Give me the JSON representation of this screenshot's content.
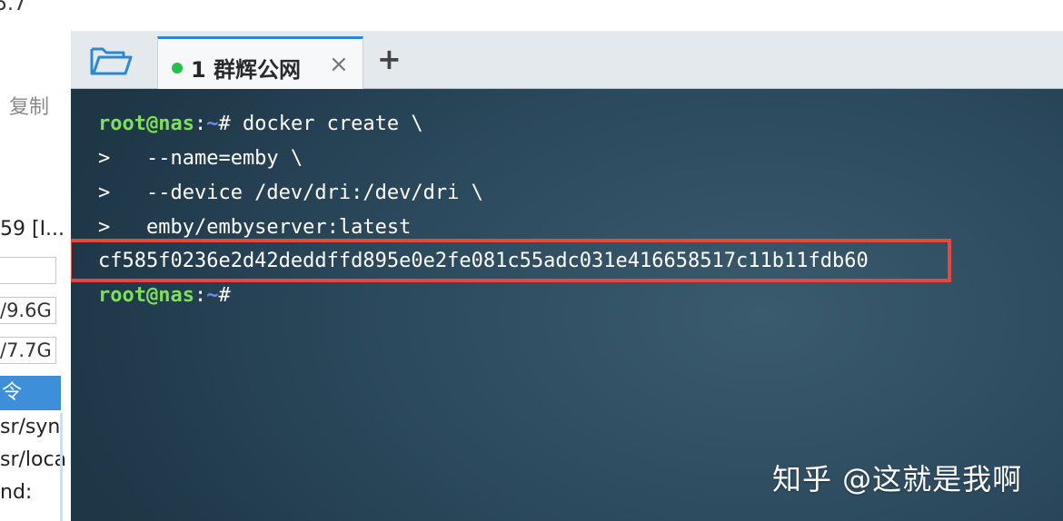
{
  "left_panel": {
    "version_fragment": "5.7",
    "copy_label": "复制",
    "truncated_item": "59 [I...",
    "field_1": "/9.6G",
    "field_2": "/7.7G",
    "selected_row": "令",
    "path_1": "sr/syn",
    "path_2": "sr/loca",
    "label_nd": "nd:"
  },
  "tabbar": {
    "tab_label": "1 群辉公网",
    "close_symbol": "×",
    "add_symbol": "+"
  },
  "terminal": {
    "prompt_user": "root@nas",
    "prompt_sep": ":",
    "prompt_path": "~",
    "prompt_hash": "# ",
    "command": "docker create \\",
    "continuation": [
      ">   --name=emby \\",
      ">   --device /dev/dri:/dev/dri \\",
      ">   emby/embyserver:latest"
    ],
    "output": "cf585f0236e2d42deddffd895e0e2fe081c55adc031e416658517c11b11fdb60",
    "prompt2_hash": "#"
  },
  "watermark": "知乎 @这就是我啊",
  "colors": {
    "prompt_green": "#7ee05a",
    "path_blue": "#6e8cf0",
    "highlight_red": "#e8473d",
    "tab_accent": "#2e87d4",
    "status_dot": "#1ec24a"
  }
}
